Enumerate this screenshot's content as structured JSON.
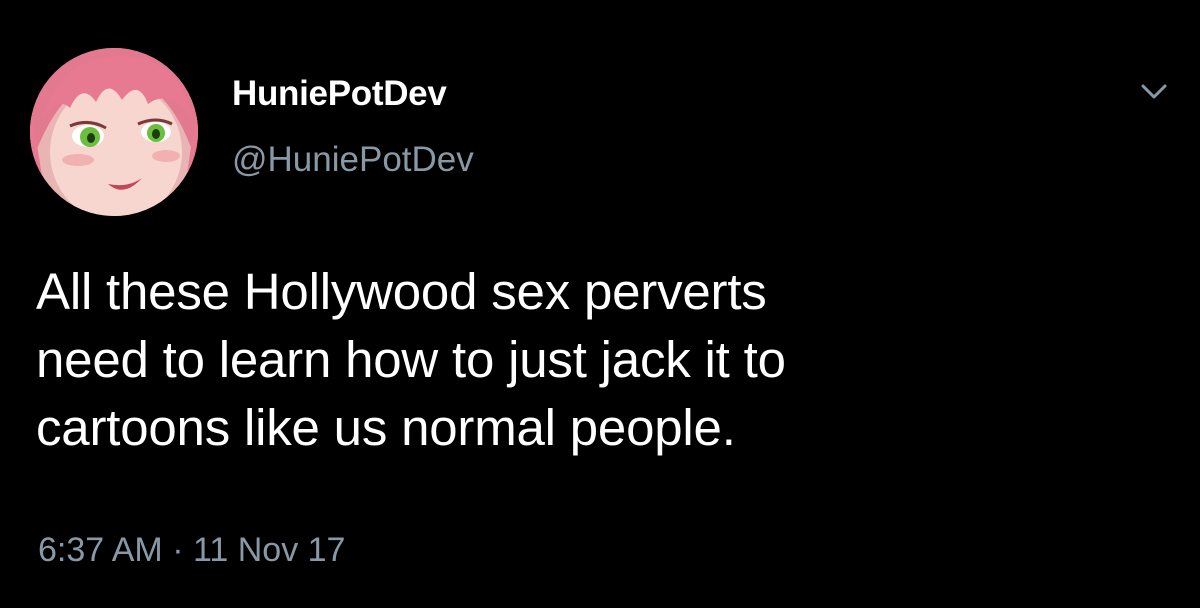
{
  "tweet": {
    "display_name": "HuniePotDev",
    "handle": "@HuniePotDev",
    "text_lines": [
      "All these Hollywood sex perverts",
      "need to learn how to just jack it to",
      "cartoons like us normal people."
    ],
    "time": "6:37 AM",
    "separator": "·",
    "date": "11 Nov 17"
  },
  "icons": {
    "avatar": "anime-avatar",
    "menu": "chevron-down-icon"
  },
  "colors": {
    "background": "#000000",
    "text": "#ffffff",
    "secondary_text": "#8899a6"
  }
}
